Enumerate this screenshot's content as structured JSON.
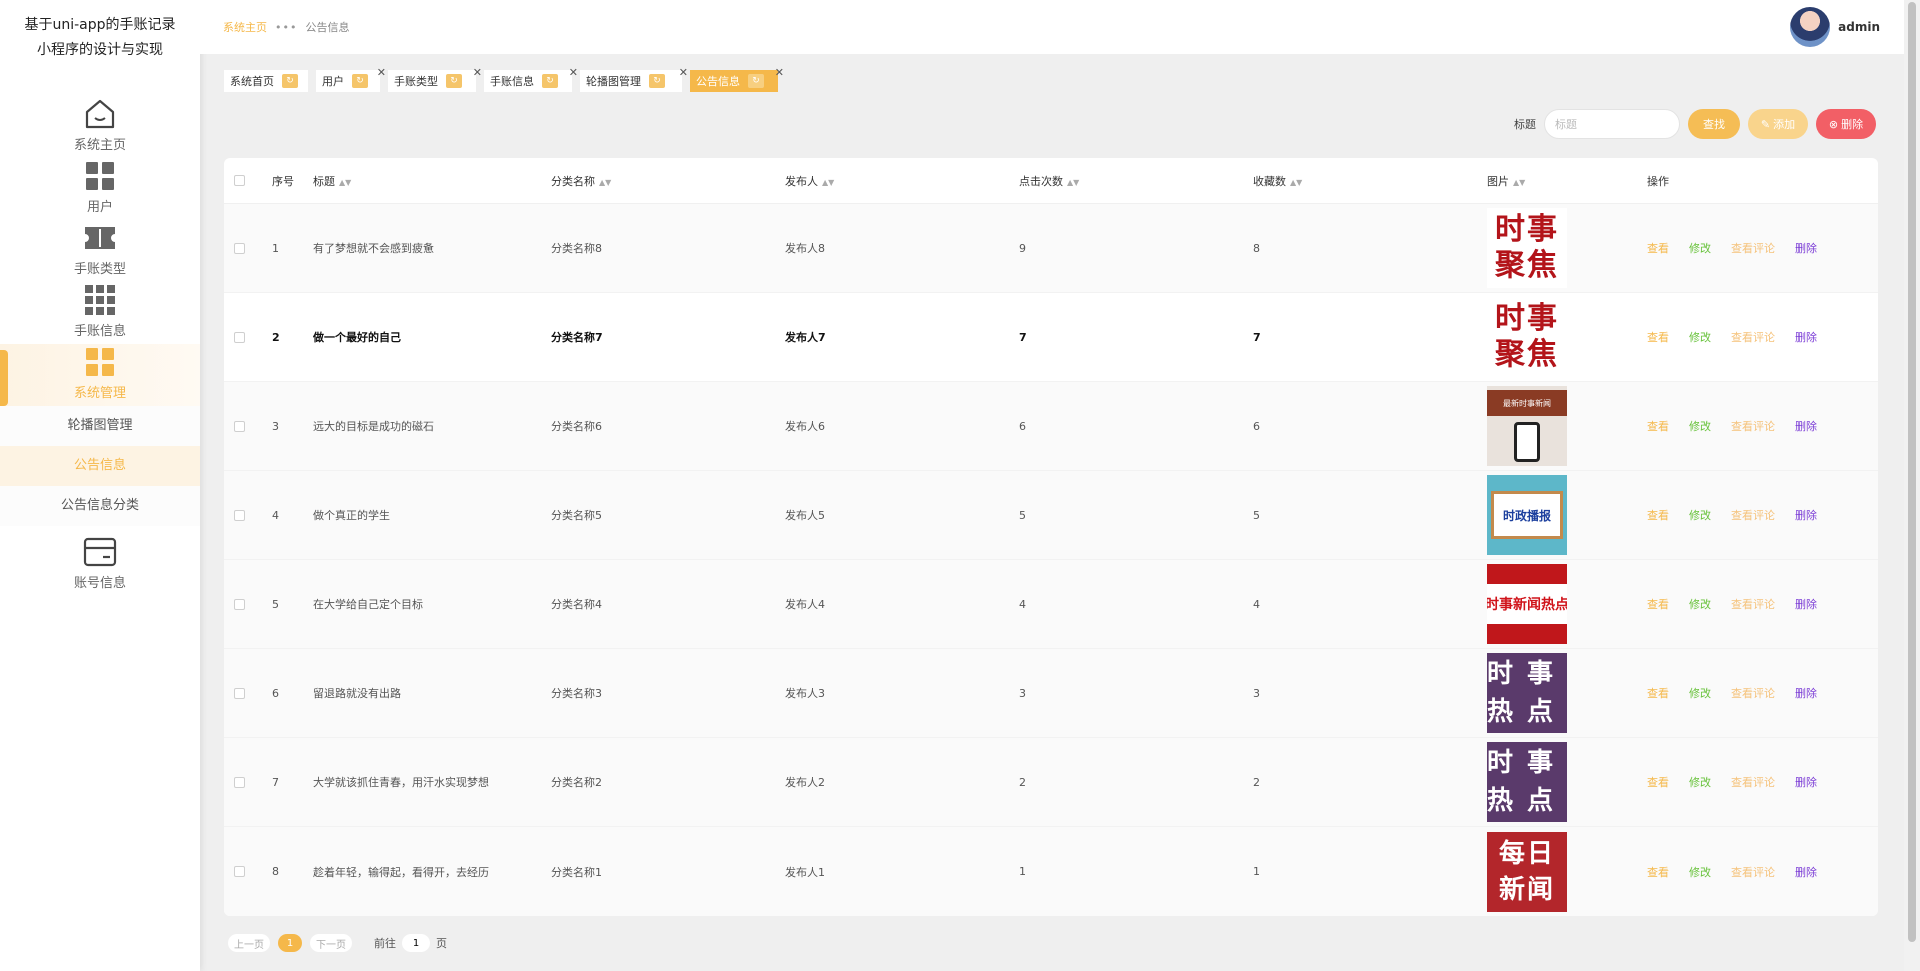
{
  "app": {
    "title_line1": "基于uni-app的手账记录",
    "title_line2": "小程序的设计与实现"
  },
  "sidebar": {
    "items": [
      {
        "label": "系统主页",
        "icon": "home-icon"
      },
      {
        "label": "用户",
        "icon": "grid-four-icon"
      },
      {
        "label": "手账类型",
        "icon": "ticket-icon"
      },
      {
        "label": "手账信息",
        "icon": "grid-nine-icon"
      },
      {
        "label": "系统管理",
        "icon": "grid-four-icon"
      },
      {
        "label": "账号信息",
        "icon": "card-icon"
      }
    ],
    "submenu": [
      {
        "label": "轮播图管理"
      },
      {
        "label": "公告信息"
      },
      {
        "label": "公告信息分类"
      }
    ]
  },
  "header": {
    "breadcrumb_home": "系统主页",
    "breadcrumb_sep": "•••",
    "breadcrumb_current": "公告信息",
    "username": "admin"
  },
  "tabs": [
    {
      "label": "系统首页"
    },
    {
      "label": "用户"
    },
    {
      "label": "手账类型"
    },
    {
      "label": "手账信息"
    },
    {
      "label": "轮播图管理"
    },
    {
      "label": "公告信息"
    }
  ],
  "search": {
    "label": "标题",
    "placeholder": "标题",
    "search_btn": "查找",
    "add_btn": "添加",
    "delete_btn": "删除"
  },
  "table": {
    "headers": {
      "index": "序号",
      "title": "标题",
      "category": "分类名称",
      "publisher": "发布人",
      "clicks": "点击次数",
      "favorites": "收藏数",
      "image": "图片",
      "actions": "操作"
    },
    "actions": {
      "view": "查看",
      "edit": "修改",
      "comments": "查看评论",
      "delete": "删除"
    },
    "rows": [
      {
        "index": "1",
        "title": "有了梦想就不会感到疲惫",
        "category": "分类名称8",
        "publisher": "发布人8",
        "clicks": "9",
        "favorites": "8",
        "image_text": "时事聚焦"
      },
      {
        "index": "2",
        "title": "做一个最好的自己",
        "category": "分类名称7",
        "publisher": "发布人7",
        "clicks": "7",
        "favorites": "7",
        "image_text": "时事聚焦"
      },
      {
        "index": "3",
        "title": "远大的目标是成功的磁石",
        "category": "分类名称6",
        "publisher": "发布人6",
        "clicks": "6",
        "favorites": "6",
        "image_text": "最新时事新闻"
      },
      {
        "index": "4",
        "title": "做个真正的学生",
        "category": "分类名称5",
        "publisher": "发布人5",
        "clicks": "5",
        "favorites": "5",
        "image_text": "时政播报"
      },
      {
        "index": "5",
        "title": "在大学给自己定个目标",
        "category": "分类名称4",
        "publisher": "发布人4",
        "clicks": "4",
        "favorites": "4",
        "image_text": "时事新闻热点"
      },
      {
        "index": "6",
        "title": "留退路就没有出路",
        "category": "分类名称3",
        "publisher": "发布人3",
        "clicks": "3",
        "favorites": "3",
        "image_text": "时事热点"
      },
      {
        "index": "7",
        "title": "大学就该抓住青春，用汗水实现梦想",
        "category": "分类名称2",
        "publisher": "发布人2",
        "clicks": "2",
        "favorites": "2",
        "image_text": "时事热点"
      },
      {
        "index": "8",
        "title": "趁着年轻，输得起，看得开，去经历",
        "category": "分类名称1",
        "publisher": "发布人1",
        "clicks": "1",
        "favorites": "1",
        "image_text": "每日新闻"
      }
    ]
  },
  "pagination": {
    "prev": "上一页",
    "current": "1",
    "next": "下一页",
    "goto_label": "前往",
    "goto_value": "1",
    "page_suffix": "页"
  },
  "colors": {
    "accent": "#f5b84a",
    "edit": "#67c23a",
    "delete_link": "#7b3cd6",
    "delete_button": "#f25f66"
  }
}
